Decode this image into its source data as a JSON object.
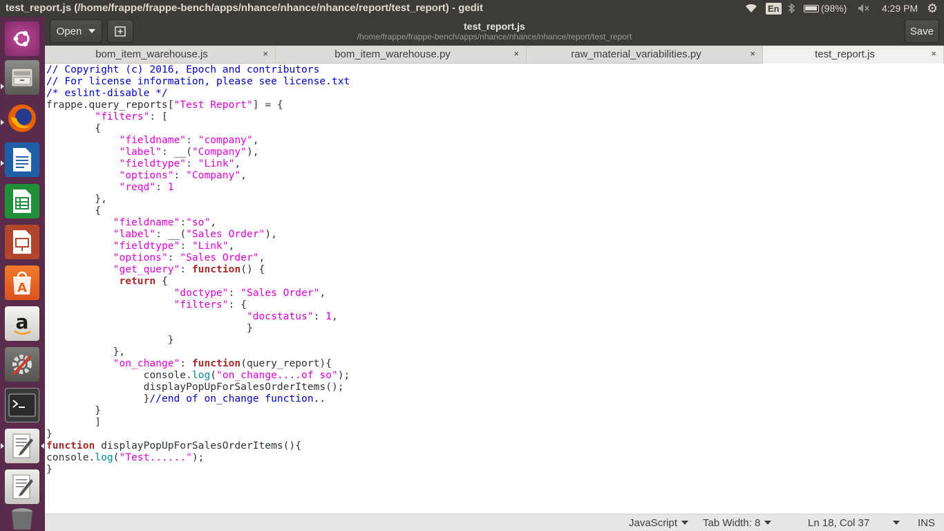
{
  "window_title": "test_report.js (/home/frappe/frappe-bench/apps/nhance/nhance/nhance/report/test_report) - gedit",
  "indicators": {
    "keyboard": "En",
    "battery": "(98%)",
    "clock": "4:29 PM"
  },
  "launcher": {
    "items": [
      "ubuntu-dash",
      "files",
      "firefox",
      "libreoffice-writer",
      "libreoffice-calc",
      "libreoffice-impress",
      "ubuntu-software",
      "amazon",
      "system-settings",
      "terminal",
      "text-editor",
      "text-editor-2",
      "trash"
    ]
  },
  "header": {
    "open_label": "Open",
    "save_label": "Save",
    "doc_title": "test_report.js",
    "doc_path": "/home/frappe/frappe-bench/apps/nhance/nhance/nhance/report/test_report"
  },
  "tabs": [
    {
      "label": "bom_item_warehouse.js",
      "close": "×"
    },
    {
      "label": "bom_item_warehouse.py",
      "close": "×"
    },
    {
      "label": "raw_material_variabilities.py",
      "close": "×"
    },
    {
      "label": "test_report.js",
      "close": "×"
    }
  ],
  "code_lines": [
    [
      [
        "c",
        "// Copyright (c) 2016, Epoch and contributors"
      ]
    ],
    [
      [
        "c",
        "// For license information, please see license.txt"
      ]
    ],
    [
      [
        "c",
        "/* eslint-disable */"
      ]
    ],
    [
      [
        "p",
        "frappe.query_reports["
      ],
      [
        "s",
        "\"Test Report\""
      ],
      [
        "p",
        "] = {"
      ]
    ],
    [
      [
        "p",
        "        "
      ],
      [
        "s",
        "\"filters\""
      ],
      [
        "p",
        ": ["
      ]
    ],
    [
      [
        "p",
        "        {"
      ]
    ],
    [
      [
        "p",
        "            "
      ],
      [
        "s",
        "\"fieldname\""
      ],
      [
        "p",
        ": "
      ],
      [
        "s",
        "\"company\""
      ],
      [
        "p",
        ","
      ]
    ],
    [
      [
        "p",
        "            "
      ],
      [
        "s",
        "\"label\""
      ],
      [
        "p",
        ": __("
      ],
      [
        "s",
        "\"Company\""
      ],
      [
        "p",
        "),"
      ]
    ],
    [
      [
        "p",
        "            "
      ],
      [
        "s",
        "\"fieldtype\""
      ],
      [
        "p",
        ": "
      ],
      [
        "s",
        "\"Link\""
      ],
      [
        "p",
        ","
      ]
    ],
    [
      [
        "p",
        "            "
      ],
      [
        "s",
        "\"options\""
      ],
      [
        "p",
        ": "
      ],
      [
        "s",
        "\"Company\""
      ],
      [
        "p",
        ","
      ]
    ],
    [
      [
        "p",
        "            "
      ],
      [
        "s",
        "\"reqd\""
      ],
      [
        "p",
        ": "
      ],
      [
        "n",
        "1"
      ]
    ],
    [
      [
        "p",
        "        },"
      ]
    ],
    [
      [
        "p",
        "        {"
      ]
    ],
    [
      [
        "p",
        "           "
      ],
      [
        "s",
        "\"fieldname\""
      ],
      [
        "p",
        ":"
      ],
      [
        "s",
        "\"so\""
      ],
      [
        "p",
        ","
      ]
    ],
    [
      [
        "p",
        "           "
      ],
      [
        "s",
        "\"label\""
      ],
      [
        "p",
        ": __("
      ],
      [
        "s",
        "\"Sales Order\""
      ],
      [
        "p",
        "),"
      ]
    ],
    [
      [
        "p",
        "           "
      ],
      [
        "s",
        "\"fieldtype\""
      ],
      [
        "p",
        ": "
      ],
      [
        "s",
        "\"Link\""
      ],
      [
        "p",
        ","
      ]
    ],
    [
      [
        "p",
        "           "
      ],
      [
        "s",
        "\"options\""
      ],
      [
        "p",
        ": "
      ],
      [
        "s",
        "\"Sales Order\""
      ],
      [
        "p",
        ","
      ]
    ],
    [
      [
        "p",
        "           "
      ],
      [
        "s",
        "\"get_query\""
      ],
      [
        "p",
        ": "
      ],
      [
        "k",
        "function"
      ],
      [
        "p",
        "() {"
      ]
    ],
    [
      [
        "p",
        "            "
      ],
      [
        "k",
        "return"
      ],
      [
        "p",
        " {"
      ]
    ],
    [
      [
        "p",
        "                     "
      ],
      [
        "s",
        "\"doctype\""
      ],
      [
        "p",
        ": "
      ],
      [
        "s",
        "\"Sales Order\""
      ],
      [
        "p",
        ","
      ]
    ],
    [
      [
        "p",
        "                     "
      ],
      [
        "s",
        "\"filters\""
      ],
      [
        "p",
        ": {"
      ]
    ],
    [
      [
        "p",
        "                                 "
      ],
      [
        "s",
        "\"docstatus\""
      ],
      [
        "p",
        ": "
      ],
      [
        "n",
        "1"
      ],
      [
        "p",
        ","
      ]
    ],
    [
      [
        "p",
        "                                 }"
      ]
    ],
    [
      [
        "p",
        "                    }"
      ]
    ],
    [
      [
        "p",
        "           },"
      ]
    ],
    [
      [
        "p",
        "           "
      ],
      [
        "s",
        "\"on_change\""
      ],
      [
        "p",
        ": "
      ],
      [
        "k",
        "function"
      ],
      [
        "p",
        "(query_report){"
      ]
    ],
    [
      [
        "p",
        "                console."
      ],
      [
        "f",
        "log"
      ],
      [
        "p",
        "("
      ],
      [
        "s",
        "\"on_change....of so\""
      ],
      [
        "p",
        ");"
      ]
    ],
    [
      [
        "p",
        "                displayPopUpForSalesOrderItems();"
      ]
    ],
    [
      [
        "p",
        "                }"
      ],
      [
        "c",
        "//end of on_change function.."
      ]
    ],
    [
      [
        "p",
        "        }"
      ]
    ],
    [
      [
        "p",
        "        ]"
      ]
    ],
    [
      [
        "p",
        "}"
      ]
    ],
    [
      [
        "k",
        "function"
      ],
      [
        "p",
        " displayPopUpForSalesOrderItems(){"
      ]
    ],
    [
      [
        "p",
        "console."
      ],
      [
        "f",
        "log"
      ],
      [
        "p",
        "("
      ],
      [
        "s",
        "\"Test......\""
      ],
      [
        "p",
        ");"
      ]
    ],
    [
      [
        "p",
        "}"
      ]
    ]
  ],
  "status": {
    "language": "JavaScript",
    "tab_width": "Tab Width: 8",
    "position": "Ln 18, Col 37",
    "mode": "INS"
  }
}
